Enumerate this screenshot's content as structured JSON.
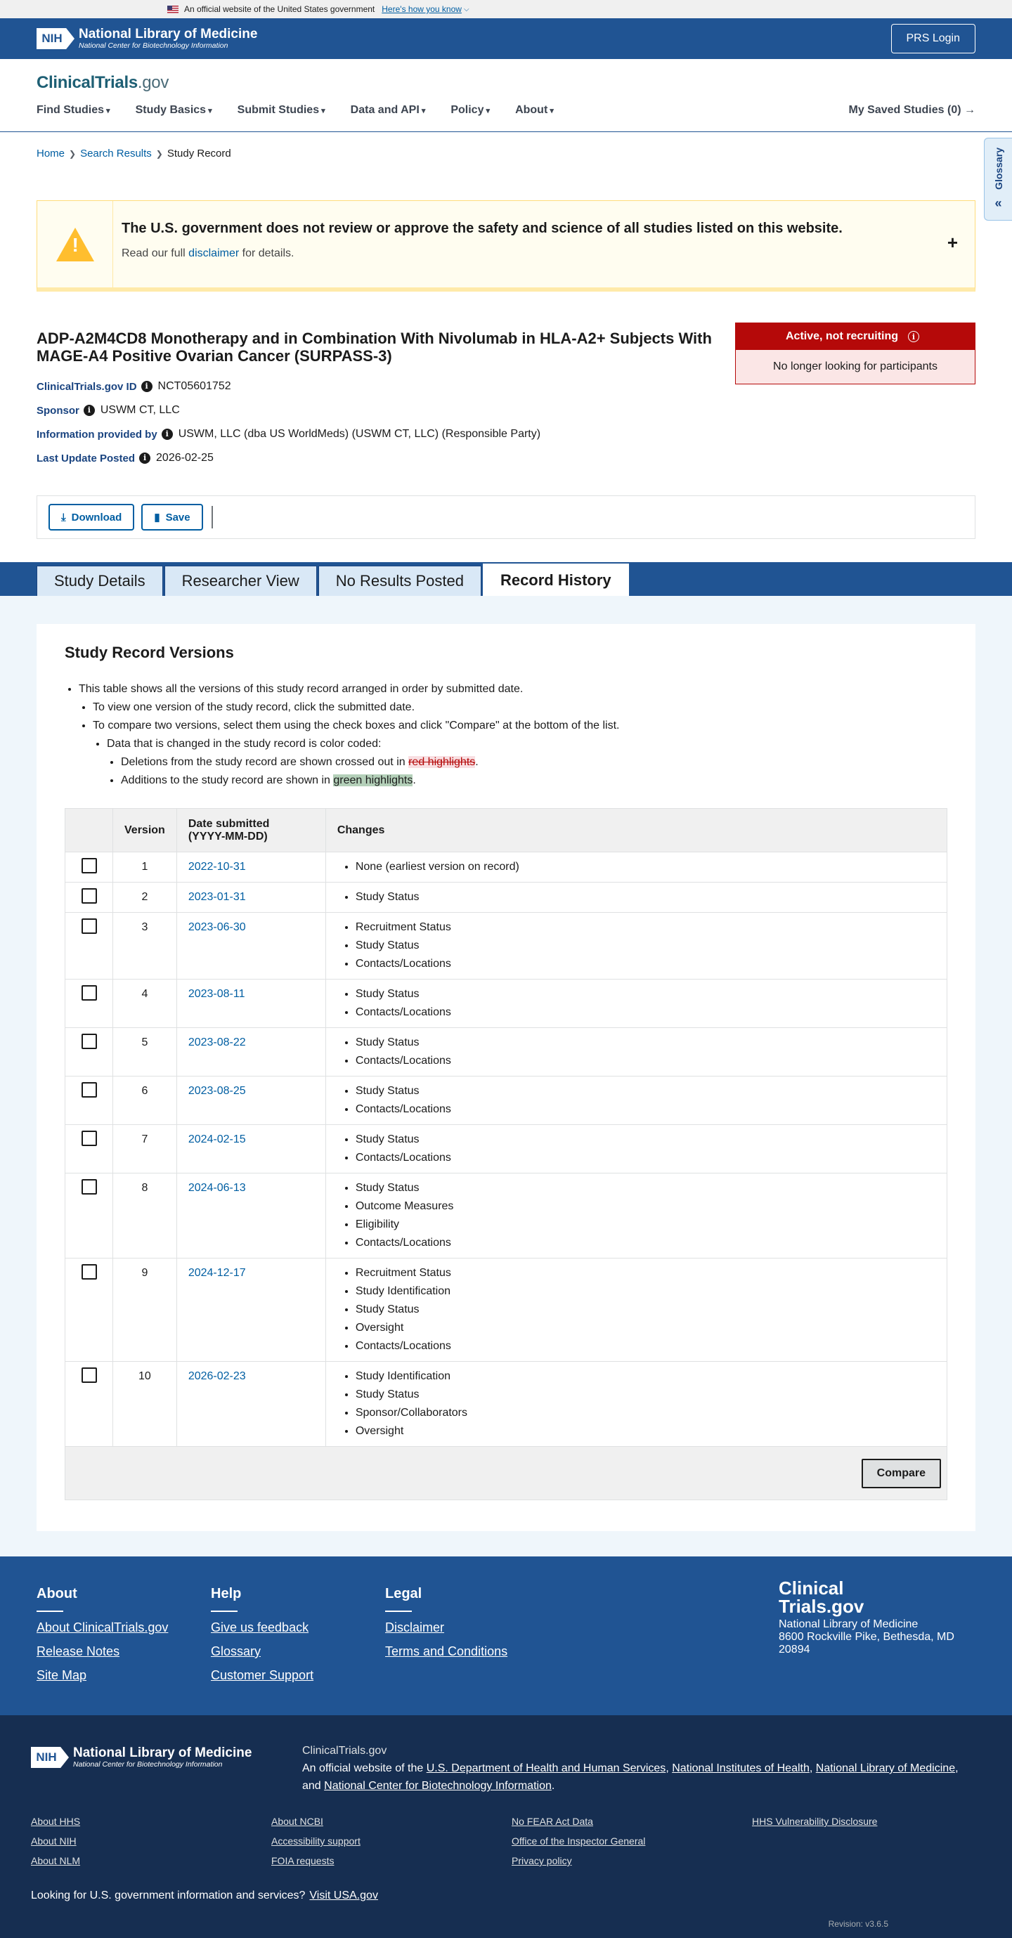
{
  "gov_banner": {
    "text": "An official website of the United States government",
    "link": "Here's how you know"
  },
  "nih_header": {
    "logo_mark": "NIH",
    "logo_title": "National Library of Medicine",
    "logo_subtitle": "National Center for Biotechnology Information",
    "prs_login": "PRS Login"
  },
  "site": {
    "logo_main": "ClinicalTrials",
    "logo_suffix": ".gov"
  },
  "nav": {
    "items": [
      "Find Studies",
      "Study Basics",
      "Submit Studies",
      "Data and API",
      "Policy",
      "About"
    ],
    "saved": "My Saved Studies (0)"
  },
  "glossary": {
    "label": "Glossary",
    "icon": "«"
  },
  "breadcrumb": {
    "home": "Home",
    "search": "Search Results",
    "current": "Study Record"
  },
  "alert": {
    "title": "The U.S. government does not review or approve the safety and science of all studies listed on this website.",
    "body_pre": "Read our full ",
    "body_link": "disclaimer",
    "body_post": " for details.",
    "icon": "!",
    "expand": "+"
  },
  "study": {
    "title": "ADP-A2M4CD8 Monotherapy and in Combination With Nivolumab in HLA-A2+ Subjects With MAGE-A4 Positive Ovarian Cancer (SURPASS-3)",
    "id_label": "ClinicalTrials.gov ID",
    "id_value": "NCT05601752",
    "sponsor_label": "Sponsor",
    "sponsor_value": "USWM CT, LLC",
    "provided_label": "Information provided by",
    "provided_value": "USWM, LLC (dba US WorldMeds) (USWM CT, LLC) (Responsible Party)",
    "updated_label": "Last Update Posted",
    "updated_value": "2026-02-25",
    "status_top": "Active, not recruiting",
    "status_bottom": "No longer looking for participants"
  },
  "actions": {
    "download": "Download",
    "save": "Save"
  },
  "tabs": [
    {
      "label": "Study Details"
    },
    {
      "label": "Researcher View"
    },
    {
      "label": "No Results Posted"
    },
    {
      "label": "Record History"
    }
  ],
  "history": {
    "heading": "Study Record Versions",
    "intro1": "This table shows all the versions of this study record arranged in order by submitted date.",
    "intro2": "To view one version of the study record, click the submitted date.",
    "intro3": "To compare two versions, select them using the check boxes and click \"Compare\" at the bottom of the list.",
    "intro4": "Data that is changed in the study record is color coded:",
    "del_pre": "Deletions from the study record are shown crossed out in ",
    "del_hl": "red highlights",
    "add_pre": "Additions to the study record are shown in ",
    "add_hl": "green highlights",
    "period": ".",
    "col_version": "Version",
    "col_date_1": "Date submitted",
    "col_date_2": "(YYYY-MM-DD)",
    "col_changes": "Changes",
    "compare": "Compare",
    "rows": [
      {
        "version": "1",
        "date": "2022-10-31",
        "changes": [
          "None (earliest version on record)"
        ]
      },
      {
        "version": "2",
        "date": "2023-01-31",
        "changes": [
          "Study Status"
        ]
      },
      {
        "version": "3",
        "date": "2023-06-30",
        "changes": [
          "Recruitment Status",
          "Study Status",
          "Contacts/Locations"
        ]
      },
      {
        "version": "4",
        "date": "2023-08-11",
        "changes": [
          "Study Status",
          "Contacts/Locations"
        ]
      },
      {
        "version": "5",
        "date": "2023-08-22",
        "changes": [
          "Study Status",
          "Contacts/Locations"
        ]
      },
      {
        "version": "6",
        "date": "2023-08-25",
        "changes": [
          "Study Status",
          "Contacts/Locations"
        ]
      },
      {
        "version": "7",
        "date": "2024-02-15",
        "changes": [
          "Study Status",
          "Contacts/Locations"
        ]
      },
      {
        "version": "8",
        "date": "2024-06-13",
        "changes": [
          "Study Status",
          "Outcome Measures",
          "Eligibility",
          "Contacts/Locations"
        ]
      },
      {
        "version": "9",
        "date": "2024-12-17",
        "changes": [
          "Recruitment Status",
          "Study Identification",
          "Study Status",
          "Oversight",
          "Contacts/Locations"
        ]
      },
      {
        "version": "10",
        "date": "2026-02-23",
        "changes": [
          "Study Identification",
          "Study Status",
          "Sponsor/Collaborators",
          "Oversight"
        ]
      }
    ]
  },
  "footer": {
    "about_h": "About",
    "about_links": [
      "About ClinicalTrials.gov",
      "Release Notes",
      "Site Map"
    ],
    "help_h": "Help",
    "help_links": [
      "Give us feedback",
      "Glossary",
      "Customer Support"
    ],
    "legal_h": "Legal",
    "legal_links": [
      "Disclaimer",
      "Terms and Conditions"
    ],
    "brand_1": "Clinical",
    "brand_2": "Trials.gov",
    "addr_1": "National Library of Medicine",
    "addr_2": "8600 Rockville Pike, Bethesda, MD 20894"
  },
  "nlm_footer": {
    "site": "ClinicalTrials.gov",
    "official_pre": "An official website of the ",
    "l1": "U.S. Department of Health and Human Services",
    "l2": "National Institutes of Health",
    "l3": "National Library of Medicine",
    "and": "and ",
    "l4": "National Center for Biotechnology Information",
    "col1": [
      "About HHS",
      "About NIH",
      "About NLM"
    ],
    "col2": [
      "About NCBI",
      "Accessibility support",
      "FOIA requests"
    ],
    "col3": [
      "No FEAR Act Data",
      "Office of the Inspector General",
      "Privacy policy"
    ],
    "col4": [
      "HHS Vulnerability Disclosure"
    ],
    "looking": "Looking for U.S. government information and services?",
    "usa": "Visit USA.gov",
    "revision": "Revision: v3.6.5"
  },
  "colors": {
    "nih_blue": "#205493",
    "navy": "#162e51",
    "status_red": "#b50909",
    "link": "#005ea2"
  }
}
